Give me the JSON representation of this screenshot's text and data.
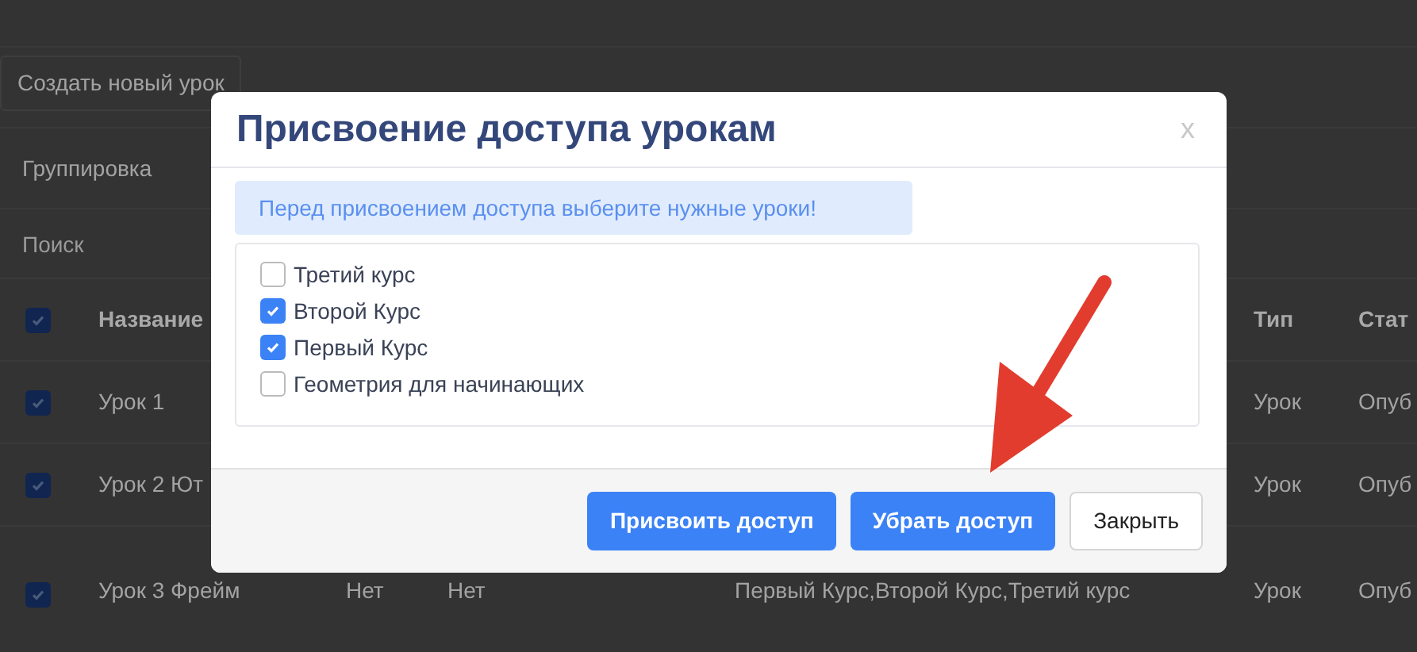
{
  "page": {
    "create_button": "Создать новый урок",
    "grouping": "Группировка",
    "search": {
      "placeholder": "Поиск"
    },
    "table": {
      "header": {
        "checked": true,
        "name": "Название",
        "type": "Тип",
        "status": "Стат"
      },
      "rows": [
        {
          "checked": true,
          "name": "Урок 1",
          "type": "Урок",
          "status": "Опуб"
        },
        {
          "checked": true,
          "name": "Урок 2 Ют",
          "type": "Урок",
          "status": "Опуб"
        },
        {
          "checked": true,
          "name": "Урок 3 Фрейм",
          "column_3": "Нет",
          "column_4": "Нет",
          "courses": "Первый Курс,Второй Курс,Третий курс",
          "type": "Урок",
          "status": "Опуб"
        }
      ]
    }
  },
  "dialog": {
    "title": "Присвоение доступа урокам",
    "close": "x",
    "alert": "Перед присвоением доступа выберите нужные уроки!",
    "courses": [
      {
        "label": "Третий курс",
        "checked": false
      },
      {
        "label": "Второй Курс",
        "checked": true
      },
      {
        "label": "Первый Курс",
        "checked": true
      },
      {
        "label": "Геометрия для начинающих",
        "checked": false
      }
    ],
    "buttons": [
      {
        "label": "Присвоить доступ",
        "kind": "primary"
      },
      {
        "label": "Убрать доступ",
        "kind": "primary"
      },
      {
        "label": "Закрыть",
        "kind": "secondary"
      }
    ]
  }
}
